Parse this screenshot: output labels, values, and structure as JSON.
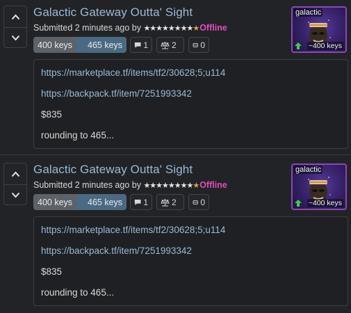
{
  "listings": [
    {
      "title": "Galactic Gateway Outta' Sight",
      "meta_prefix": "Submitted 2 minutes ago by",
      "user_stars": "★★★★★★★★",
      "user_star_highlight": "★",
      "user_status": "Offline",
      "price_buy": "400 keys",
      "price_sell": "465 keys",
      "comments": "1",
      "trades": "2",
      "stock": "0",
      "item_name": "galactic",
      "item_value": "~400 keys",
      "detail_lines": [
        "https://marketplace.tf/items/tf2/30628;5;u114",
        "https://backpack.tf/item/7251993342",
        "$835",
        "rounding to 465..."
      ]
    },
    {
      "title": "Galactic Gateway Outta' Sight",
      "meta_prefix": "Submitted 2 minutes ago by",
      "user_stars": "★★★★★★★★",
      "user_star_highlight": "★",
      "user_status": "Offline",
      "price_buy": "400 keys",
      "price_sell": "465 keys",
      "comments": "1",
      "trades": "2",
      "stock": "0",
      "item_name": "galactic",
      "item_value": "~400 keys",
      "detail_lines": [
        "https://marketplace.tf/items/tf2/30628;5;u114",
        "https://backpack.tf/item/7251993342",
        "$835",
        "rounding to 465..."
      ]
    }
  ],
  "icons": {
    "upvote": "chevron-up-icon",
    "downvote": "chevron-down-icon",
    "comments": "speech-bubble-icon",
    "trades": "scales-icon",
    "stock": "box-icon",
    "value_trend": "arrow-up-icon"
  },
  "colors": {
    "background": "#222326",
    "title": "#9ab9d6",
    "status_offline": "#e04dbd",
    "item_border_unusual": "#8e46b7",
    "price_sell": "#4a6a83",
    "price_buy": "#5d6269",
    "trend_up": "#3ecf3e"
  }
}
